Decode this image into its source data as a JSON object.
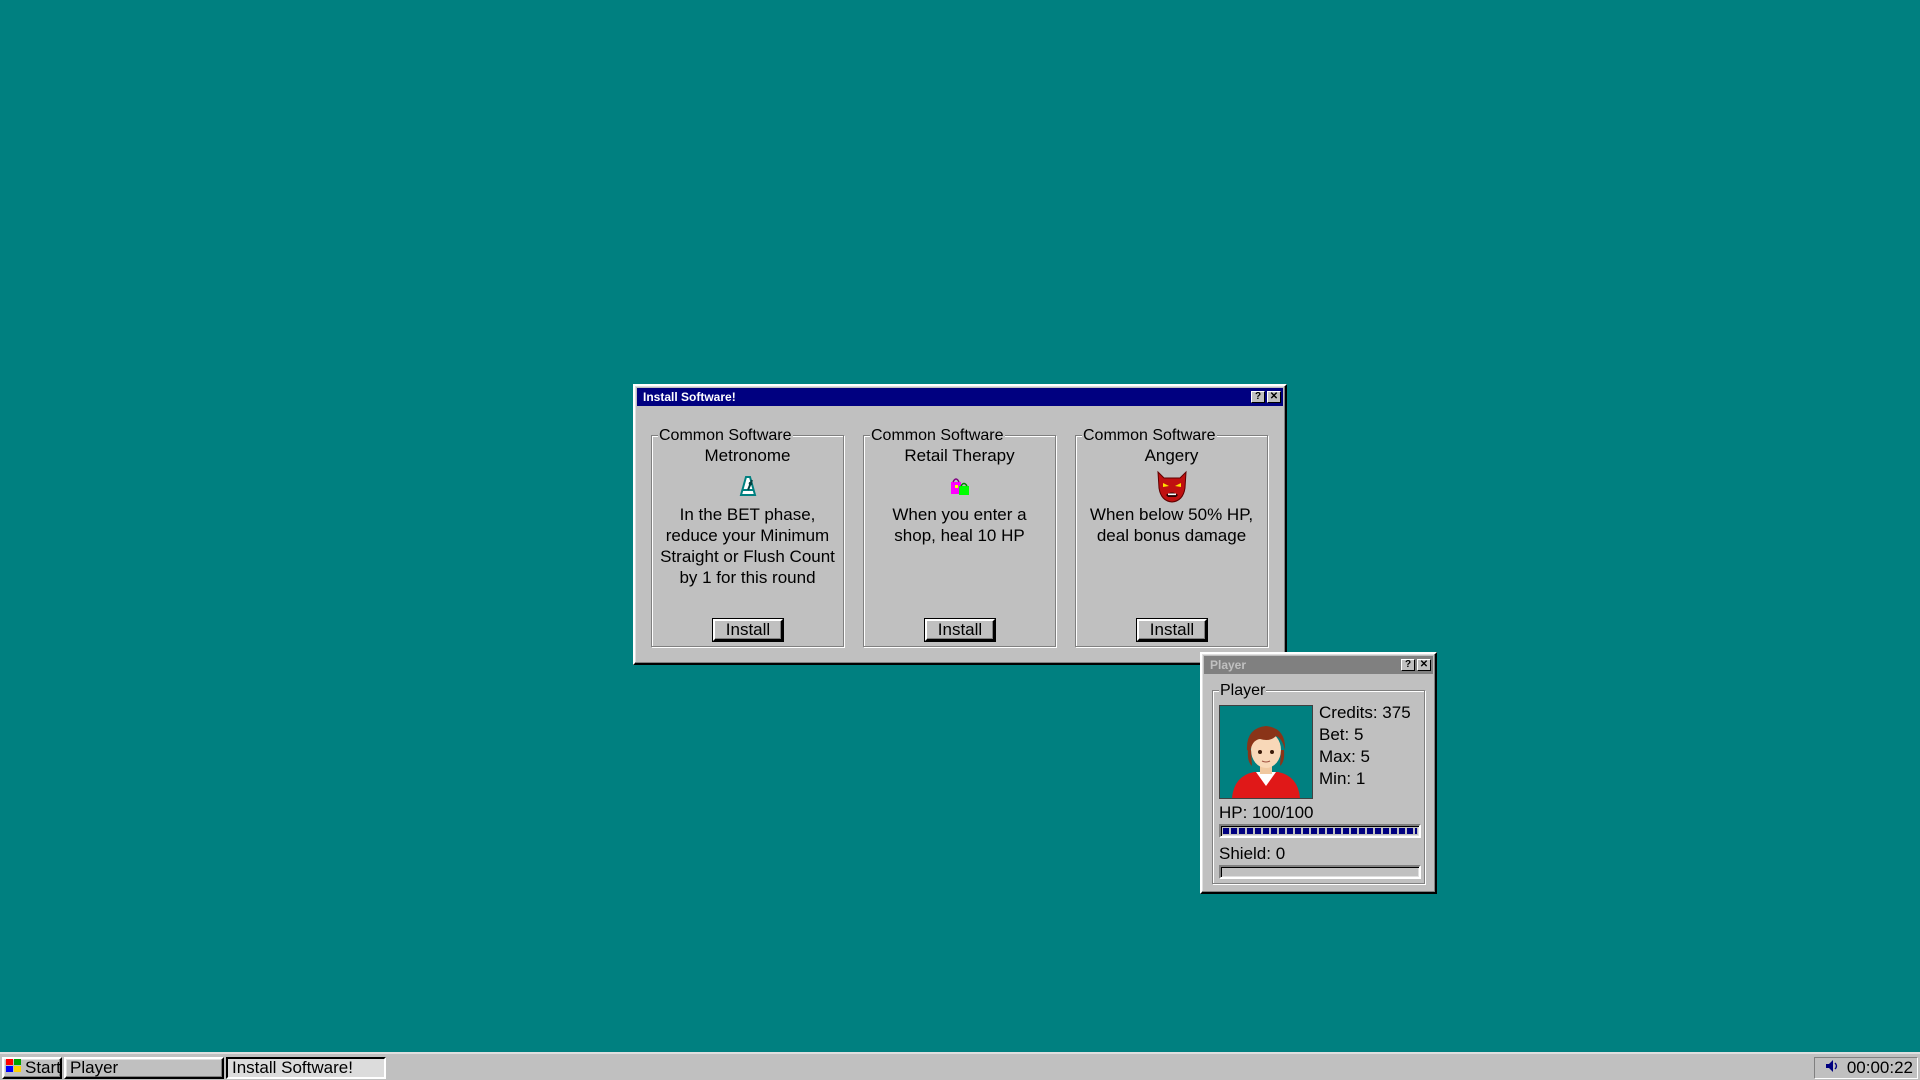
{
  "install_window": {
    "title": "Install Software!",
    "help_label": "?",
    "close_label": "✕",
    "cards": [
      {
        "category": "Common Software",
        "name": "Metronome",
        "icon": "metronome-icon",
        "description": "In the BET phase, reduce your Minimum Straight or Flush Count by 1 for this round",
        "button_label": "Install"
      },
      {
        "category": "Common Software",
        "name": "Retail Therapy",
        "icon": "shopping-bag-icon",
        "description": "When you enter a shop, heal 10 HP",
        "button_label": "Install"
      },
      {
        "category": "Common Software",
        "name": "Angery",
        "icon": "angry-face-icon",
        "description": "When below 50% HP, deal bonus damage",
        "button_label": "Install"
      }
    ]
  },
  "player_window": {
    "title": "Player",
    "help_label": "?",
    "close_label": "✕",
    "group_label": "Player",
    "credits": "Credits: 375",
    "bet": "Bet: 5",
    "max": "Max: 5",
    "min": "Min: 1",
    "hp_text": "HP: 100/100",
    "hp_fraction": 1.0,
    "shield_text": "Shield: 0",
    "shield_fraction": 0.0,
    "portrait": "player-portrait"
  },
  "taskbar": {
    "start_label": "Start",
    "tasks": [
      "Player",
      "Install Software!"
    ],
    "clock": "00:00:22"
  },
  "colors": {
    "desktop": "#008080",
    "titlebar_active": "#000080",
    "titlebar_inactive": "#808080",
    "face": "#c0c0c0"
  }
}
